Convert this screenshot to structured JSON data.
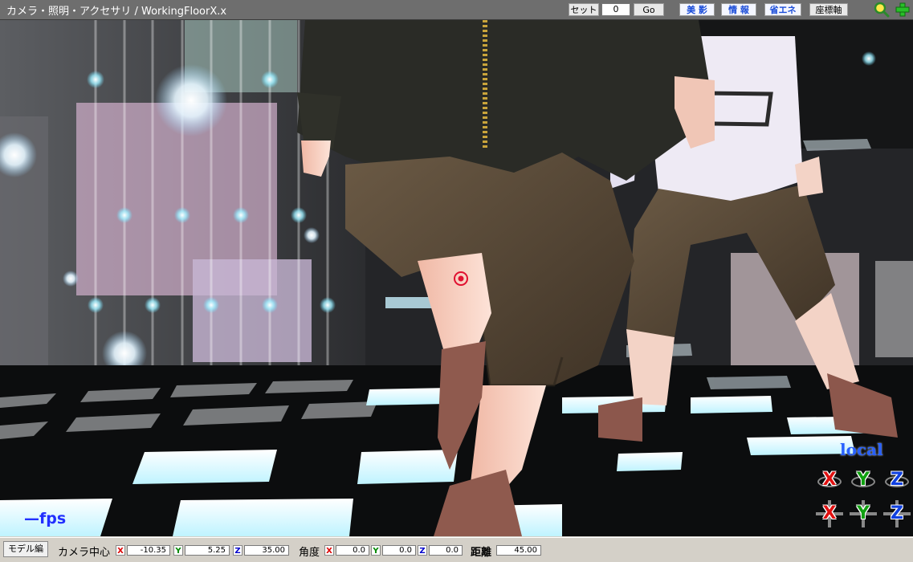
{
  "window": {
    "title": "カメラ・照明・アクセサリ / WorkingFloorX.x"
  },
  "toolbar": {
    "set_label": "セット",
    "frame_value": "0",
    "go_label": "Go",
    "buttons": [
      "美 影",
      "情 報",
      "省エネ",
      "座標軸"
    ],
    "zoom_icon": "magnifier-icon",
    "add_icon": "plus-icon"
  },
  "viewport": {
    "fps_label": "—fps",
    "local_label": "local",
    "axis_labels": [
      "X",
      "Y",
      "Z",
      "X",
      "Y",
      "Z"
    ],
    "colors": {
      "x": "#e01010",
      "y": "#10a010",
      "z": "#1040e0"
    }
  },
  "statusbar": {
    "mode_label": "モデル編",
    "camera_center_label": "カメラ中心",
    "camera_center": {
      "x": "-10.35",
      "y": "5.25",
      "z": "35.00"
    },
    "angle_label": "角度",
    "angle": {
      "x": "0.0",
      "y": "0.0",
      "z": "0.0"
    },
    "distance_label": "距離",
    "distance": "45.00",
    "axis_letters": {
      "x": "X",
      "y": "Y",
      "z": "Z"
    }
  }
}
